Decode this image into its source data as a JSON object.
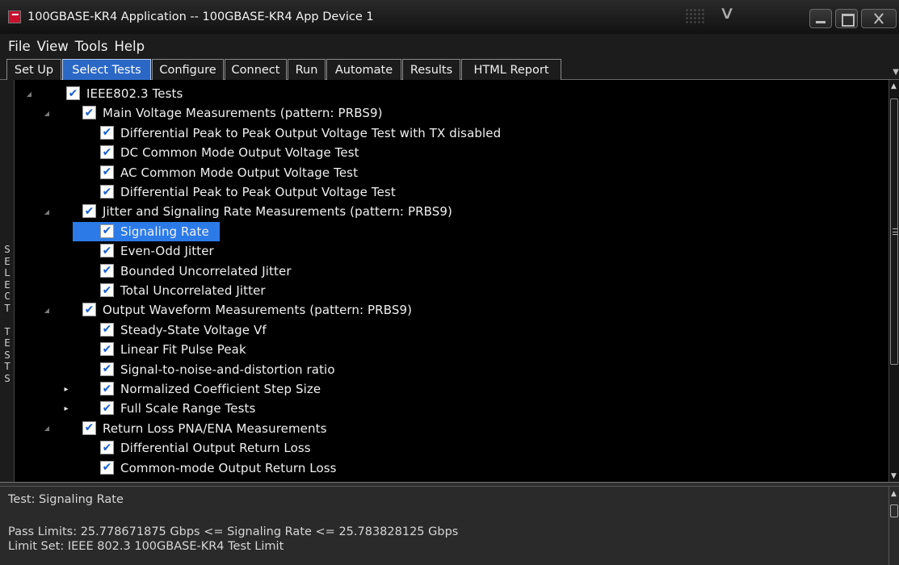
{
  "window": {
    "title": "100GBASE-KR4 Application -- 100GBASE-KR4 App Device 1"
  },
  "menu": [
    "File",
    "View",
    "Tools",
    "Help"
  ],
  "tabs": [
    {
      "label": "Set Up",
      "active": false
    },
    {
      "label": "Select Tests",
      "active": true
    },
    {
      "label": "Configure",
      "active": false
    },
    {
      "label": "Connect",
      "active": false
    },
    {
      "label": "Run",
      "active": false
    },
    {
      "label": "Automate",
      "active": false
    },
    {
      "label": "Results",
      "active": false
    },
    {
      "label": "HTML Report",
      "active": false
    }
  ],
  "side_label": "SELECT TESTS",
  "tree": [
    {
      "label": "IEEE802.3 Tests",
      "level": 0,
      "expander": "expanded",
      "checked": true
    },
    {
      "label": "Main Voltage Measurements (pattern: PRBS9)",
      "level": 1,
      "expander": "expanded",
      "checked": true
    },
    {
      "label": "Differential Peak to Peak Output Voltage Test with TX disabled",
      "level": 2,
      "expander": "none",
      "checked": true
    },
    {
      "label": "DC Common Mode Output Voltage Test",
      "level": 2,
      "expander": "none",
      "checked": true
    },
    {
      "label": "AC Common Mode Output Voltage Test",
      "level": 2,
      "expander": "none",
      "checked": true
    },
    {
      "label": "Differential Peak to Peak Output Voltage Test",
      "level": 2,
      "expander": "none",
      "checked": true
    },
    {
      "label": "Jitter and Signaling Rate Measurements (pattern: PRBS9)",
      "level": 1,
      "expander": "expanded",
      "checked": true
    },
    {
      "label": "Signaling Rate",
      "level": 2,
      "expander": "none",
      "checked": true,
      "selected": true
    },
    {
      "label": "Even-Odd Jitter",
      "level": 2,
      "expander": "none",
      "checked": true
    },
    {
      "label": "Bounded Uncorrelated Jitter",
      "level": 2,
      "expander": "none",
      "checked": true
    },
    {
      "label": "Total Uncorrelated Jitter",
      "level": 2,
      "expander": "none",
      "checked": true
    },
    {
      "label": "Output Waveform Measurements (pattern: PRBS9)",
      "level": 1,
      "expander": "expanded",
      "checked": true
    },
    {
      "label": "Steady-State Voltage Vf",
      "level": 2,
      "expander": "none",
      "checked": true
    },
    {
      "label": "Linear Fit Pulse Peak",
      "level": 2,
      "expander": "none",
      "checked": true
    },
    {
      "label": "Signal-to-noise-and-distortion ratio",
      "level": 2,
      "expander": "none",
      "checked": true
    },
    {
      "label": "Normalized Coefficient Step Size",
      "level": 2,
      "expander": "collapsed",
      "checked": true
    },
    {
      "label": "Full Scale Range Tests",
      "level": 2,
      "expander": "collapsed",
      "checked": true
    },
    {
      "label": "Return Loss PNA/ENA Measurements",
      "level": 1,
      "expander": "expanded",
      "checked": true
    },
    {
      "label": "Differential Output Return Loss",
      "level": 2,
      "expander": "none",
      "checked": true
    },
    {
      "label": "Common-mode Output Return Loss",
      "level": 2,
      "expander": "none",
      "checked": true
    }
  ],
  "info": {
    "test_line": "Test: Signaling Rate",
    "pass_limits": "Pass Limits: 25.778671875 Gbps <= Signaling Rate <= 25.783828125 Gbps",
    "limit_set": "Limit Set: IEEE 802.3 100GBASE-KR4 Test Limit"
  },
  "icons": {
    "expanded": "expanded-triangle-icon",
    "collapsed": "collapsed-triangle-icon",
    "check": "checkmark-icon"
  },
  "colors": {
    "tab_active": "#2b68c6",
    "selection": "#2b7ae8",
    "check": "#1c5fd0"
  }
}
